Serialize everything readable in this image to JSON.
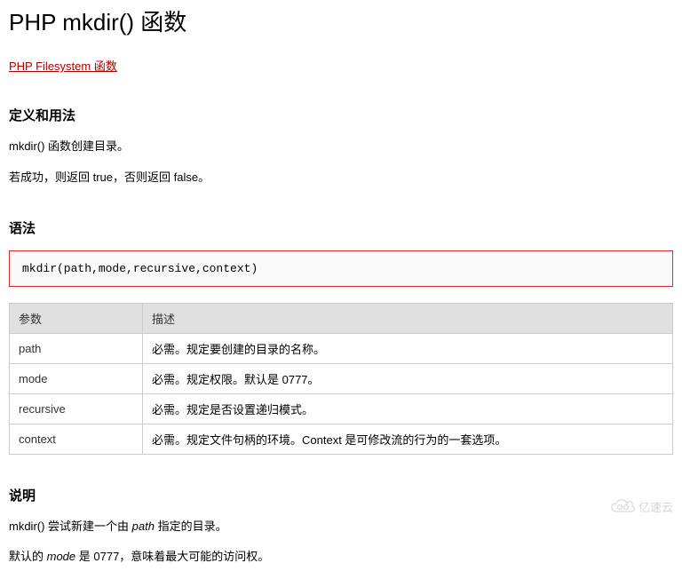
{
  "title": "PHP mkdir() 函数",
  "navLink": "PHP Filesystem 函数",
  "sections": {
    "definition": {
      "heading": "定义和用法",
      "p1": "mkdir() 函数创建目录。",
      "p2": "若成功，则返回 true，否则返回 false。"
    },
    "syntax": {
      "heading": "语法",
      "code": "mkdir(path,mode,recursive,context)"
    },
    "table": {
      "head_param": "参数",
      "head_desc": "描述",
      "rows": [
        {
          "param": "path",
          "desc": "必需。规定要创建的目录的名称。"
        },
        {
          "param": "mode",
          "desc": "必需。规定权限。默认是 0777。"
        },
        {
          "param": "recursive",
          "desc": "必需。规定是否设置递归模式。"
        },
        {
          "param": "context",
          "desc": "必需。规定文件句柄的环境。Context 是可修改流的行为的一套选项。"
        }
      ]
    },
    "explain": {
      "heading": "说明",
      "p1_pre": "mkdir() 尝试新建一个由 ",
      "p1_ital": "path",
      "p1_post": " 指定的目录。",
      "p2_pre": "默认的 ",
      "p2_ital": "mode",
      "p2_post": " 是 0777，意味着最大可能的访问权。"
    }
  },
  "watermark": "亿速云"
}
